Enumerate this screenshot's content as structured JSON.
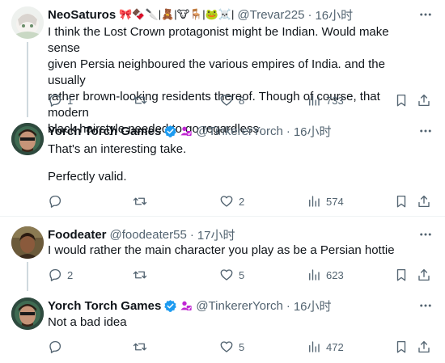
{
  "posts": [
    {
      "name": "NeoSaturos",
      "emoji": "🎀🍫🔪|🧸|🐮🪑|🐸☠️|",
      "handle": "@Trevar225",
      "time": "16小时",
      "lines": [
        "I think the Lost Crown protagonist might be Indian. Would make sense",
        "given Persia neighboured the various empires of India. and the usually",
        "rather brown-looking residents thereof. Though of course, that modern",
        "black hairstyle needed to go regardless."
      ],
      "replies": "1",
      "reposts": "",
      "likes": "8",
      "views": "733"
    },
    {
      "name": "Yorch Torch Games",
      "handle": "@TinkererYorch",
      "time": "16小时",
      "lines": [
        "That's an interesting take.",
        "",
        "Perfectly valid."
      ],
      "replies": "",
      "reposts": "",
      "likes": "2",
      "views": "574"
    },
    {
      "name": "Foodeater",
      "handle": "@foodeater55",
      "time": "17小时",
      "lines": [
        "I would rather the main character you play as be a Persian hottie"
      ],
      "replies": "2",
      "reposts": "",
      "likes": "5",
      "views": "623"
    },
    {
      "name": "Yorch Torch Games",
      "handle": "@TinkererYorch",
      "time": "16小时",
      "lines": [
        "Not a bad idea"
      ],
      "replies": "",
      "reposts": "",
      "likes": "5",
      "views": "472"
    }
  ],
  "separator": "·",
  "colors": {
    "text": "#0f1419",
    "secondary": "#536471",
    "verified": "#1d9bf0",
    "badge": "#c026d3",
    "divider": "#eff3f4"
  }
}
